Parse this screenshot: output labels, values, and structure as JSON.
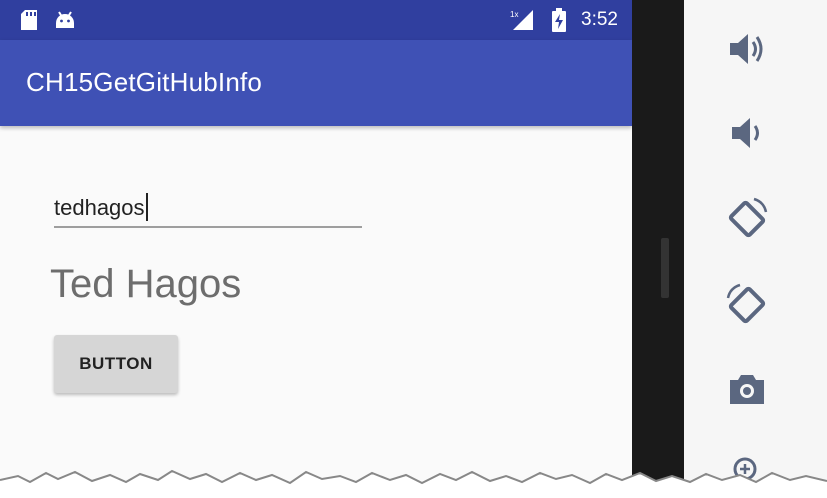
{
  "status_bar": {
    "time": "3:52",
    "left_icons": [
      "sd-card-icon",
      "android-icon"
    ],
    "right_icons": [
      "cell-signal-icon",
      "battery-charging-icon"
    ]
  },
  "app_bar": {
    "title": "CH15GetGitHubInfo"
  },
  "main": {
    "username_input": {
      "value": "tedhagos"
    },
    "name_text": "Ted Hagos",
    "button_label": "BUTTON"
  },
  "emulator_toolbar": {
    "items": [
      "volume-up-icon",
      "volume-down-icon",
      "rotate-left-icon",
      "rotate-right-icon",
      "camera-icon",
      "zoom-in-icon"
    ]
  },
  "colors": {
    "status_bar": "#303f9f",
    "app_bar": "#3f51b5",
    "background": "#fafafa",
    "button": "#d6d6d6",
    "toolbar_icon": "#5b6780"
  }
}
